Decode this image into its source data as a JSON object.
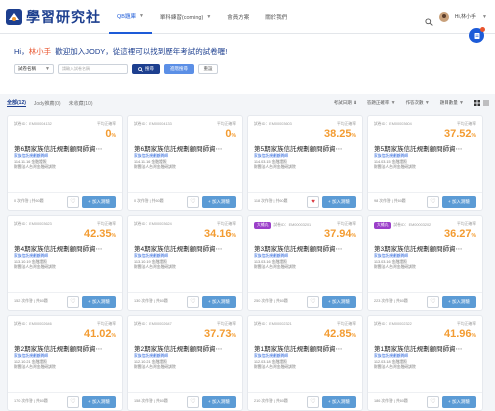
{
  "nav": {
    "brand": "學習研究社",
    "menu": [
      "QB題庫",
      "單科練習(coming)",
      "會員方案",
      "關於我們"
    ],
    "user": "Hi,林小手"
  },
  "hero": {
    "greeting_prefix": "Hi，",
    "greeting_name": "林小手",
    "greeting_suffix": "歡迎加入JODY，從這裡可以找到歷年考試的試卷喔!"
  },
  "filter": {
    "select": "試卷名稱",
    "placeholder": "請輸入試卷名稱",
    "search": "搜尋",
    "advanced": "進階搜尋",
    "reset": "重設"
  },
  "tabs": [
    "全部(12)",
    "Jody推薦(0)",
    "未收藏(10)"
  ],
  "sorts": [
    "考試日期",
    "答題正確率",
    "作答次數",
    "題目數量"
  ],
  "card_labels": {
    "avg": "平均正確率",
    "add": "加入測驗",
    "count_sep": "次作答",
    "q": "共60題",
    "sub": "家族信託規劃顧問師",
    "org": "財團法人台灣金融研訓院"
  },
  "cards": [
    {
      "id": "試卷ID：EM00004132",
      "score": "0",
      "title": "第6期家族信託規劃顧問師資⋯",
      "date": "114.11.16  金融證照",
      "count": "0 次作答",
      "tag": "",
      "fav": false
    },
    {
      "id": "試卷ID：EM00004133",
      "score": "0",
      "title": "第6期家族信託規劃顧問師資⋯",
      "date": "114.11.16  金融證照",
      "count": "0 次作答",
      "tag": "",
      "fav": false
    },
    {
      "id": "試卷ID：EM00003603",
      "score": "38.25",
      "title": "第5期家族信託規劃顧問師資⋯",
      "date": "114.03.15  金融證照",
      "count": "118 次作答",
      "tag": "",
      "fav": true
    },
    {
      "id": "試卷ID：EM00003604",
      "score": "37.52",
      "title": "第5期家族信託規劃顧問師資⋯",
      "date": "114.03.15  金融證照",
      "count": "98 次作答",
      "tag": "",
      "fav": false
    },
    {
      "id": "試卷ID：EM00003623",
      "score": "42.35",
      "title": "第4期家族信託規劃顧問師資⋯",
      "date": "113.10.19  金融證照",
      "count": "152 次作答",
      "tag": "",
      "fav": false
    },
    {
      "id": "試卷ID：EM00003624",
      "score": "34.16",
      "title": "第4期家族信託規劃顧問師資⋯",
      "date": "113.10.19  金融證照",
      "count": "130 次作答",
      "tag": "",
      "fav": false
    },
    {
      "id": "試卷ID：EM00003201",
      "score": "37.94",
      "title": "第3期家族信託規劃顧問師資⋯",
      "date": "113.03.16  金融證照",
      "count": "250 次作答",
      "tag": "大補丸",
      "fav": false
    },
    {
      "id": "試卷ID：EM00003202",
      "score": "36.27",
      "title": "第3期家族信託規劃顧問師資⋯",
      "date": "113.03.16  金融證照",
      "count": "223 次作答",
      "tag": "大補丸",
      "fav": false
    },
    {
      "id": "試卷ID：EM00002646",
      "score": "41.02",
      "title": "第2期家族信託規劃顧問師資⋯",
      "date": "112.10.21  金融證照",
      "count": "170 次作答",
      "tag": "",
      "fav": false
    },
    {
      "id": "試卷ID：EM00002647",
      "score": "37.73",
      "title": "第2期家族信託規劃顧問師資⋯",
      "date": "112.10.21  金融證照",
      "count": "158 次作答",
      "tag": "",
      "fav": false
    },
    {
      "id": "試卷ID：EM00002321",
      "score": "42.85",
      "title": "第1期家族信託規劃顧問師資⋯",
      "date": "112.03.18  金融證照",
      "count": "210 次作答",
      "tag": "",
      "fav": false
    },
    {
      "id": "試卷ID：EM00002322",
      "score": "41.96",
      "title": "第1期家族信託規劃顧問師資⋯",
      "date": "112.03.18  金融證照",
      "count": "186 次作答",
      "tag": "",
      "fav": false
    }
  ]
}
